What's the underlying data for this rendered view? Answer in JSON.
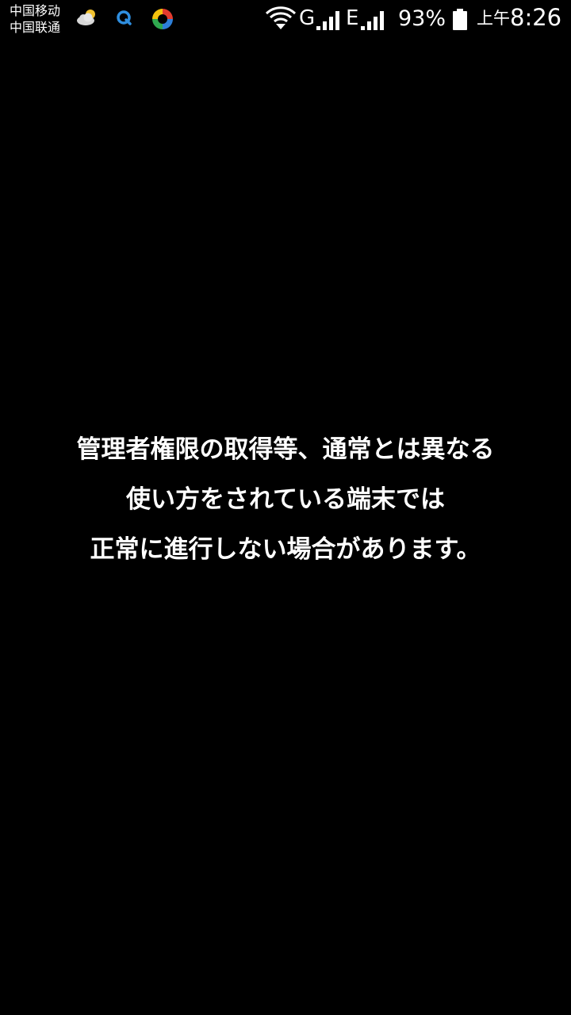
{
  "status_bar": {
    "carrier_1": "中国移动",
    "carrier_2": "中国联通",
    "notification_icons": [
      "weather-cloud-icon",
      "q-app-icon",
      "photo-app-icon"
    ],
    "wifi_icon": "wifi-icon",
    "network_1": "G",
    "network_2": "E",
    "signal_icon": "signal-strength-icon",
    "battery_percent": "93%",
    "battery_icon": "battery-icon",
    "time_period": "上午",
    "time": "8:26"
  },
  "notice": {
    "line_1": "管理者権限の取得等、通常とは異なる",
    "line_2": "使い方をされている端末では",
    "line_3": "正常に進行しない場合があります。"
  },
  "colors": {
    "background": "#000000",
    "text": "#ffffff"
  }
}
